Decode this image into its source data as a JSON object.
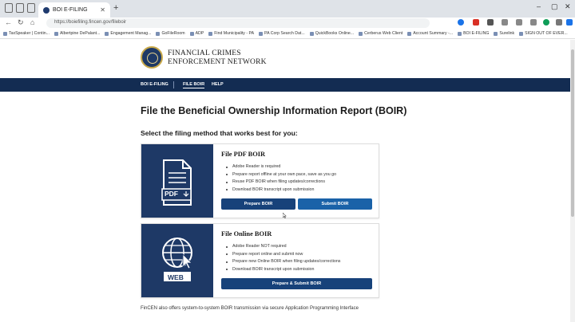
{
  "browser": {
    "tab_title": "BOI E-FILING",
    "url": "https://boiefiling.fincen.gov/fileboir",
    "bookmarks": [
      "TaxSpeaker | Contin...",
      "Albertpine DePalant...",
      "Engagement Manag...",
      "GoFileRoom",
      "ADP",
      "Find Municipality - PA",
      "PA Corp Search Dat...",
      "QuickBooks Online...",
      "Cerberus Web Client",
      "Account Summary -...",
      "BOI E-FILING",
      "Surelink",
      "SIGN OUT OF EVER..."
    ]
  },
  "header": {
    "brand_line1": "FINANCIAL CRIMES",
    "brand_line2": "ENFORCEMENT NETWORK"
  },
  "nav": {
    "items": [
      "BOI E-FILING",
      "FILE BOIR",
      "HELP"
    ]
  },
  "main": {
    "title": "File the Beneficial Ownership Information Report (BOIR)",
    "subtitle": "Select the filing method that works best for you:",
    "pdf_card": {
      "title": "File PDF BOIR",
      "icon_label": "PDF",
      "bullets": [
        "Adobe Reader is required",
        "Prepare report offline at your own pace, save as you go",
        "Reuse PDF BOIR when filing updates/corrections",
        "Download BOIR transcript upon submission"
      ],
      "prepare_button": "Prepare BOIR",
      "submit_button": "Submit BOIR"
    },
    "online_card": {
      "title": "File Online BOIR",
      "icon_label": "WEB",
      "bullets": [
        "Adobe Reader NOT required",
        "Prepare report online and submit now",
        "Prepare new Online BOIR when filing updates/corrections",
        "Download BOIR transcript upon submission"
      ],
      "button": "Prepare & Submit BOIR"
    },
    "footer_text": "FinCEN also offers system-to-system BOIR transmission via secure Application Programming Interface"
  }
}
